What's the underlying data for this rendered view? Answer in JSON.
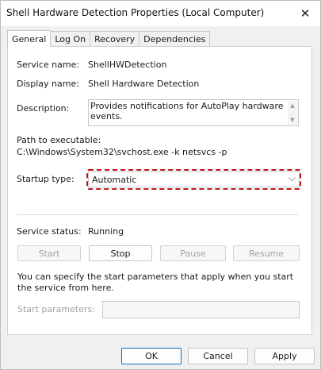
{
  "window": {
    "title": "Shell Hardware Detection Properties (Local Computer)"
  },
  "tabs": [
    {
      "label": "General",
      "active": true
    },
    {
      "label": "Log On",
      "active": false
    },
    {
      "label": "Recovery",
      "active": false
    },
    {
      "label": "Dependencies",
      "active": false
    }
  ],
  "general": {
    "service_name_label": "Service name:",
    "service_name": "ShellHWDetection",
    "display_name_label": "Display name:",
    "display_name": "Shell Hardware Detection",
    "description_label": "Description:",
    "description": "Provides notifications for AutoPlay hardware events.",
    "path_label": "Path to executable:",
    "path": "C:\\Windows\\System32\\svchost.exe -k netsvcs -p",
    "startup_type_label": "Startup type:",
    "startup_type": "Automatic",
    "status_label": "Service status:",
    "status": "Running",
    "buttons": {
      "start": "Start",
      "stop": "Stop",
      "pause": "Pause",
      "resume": "Resume"
    },
    "params_note": "You can specify the start parameters that apply when you start the service from here.",
    "params_label": "Start parameters:",
    "params_value": ""
  },
  "footer": {
    "ok": "OK",
    "cancel": "Cancel",
    "apply": "Apply"
  },
  "colors": {
    "accent": "#0f6cbd",
    "highlight": "#c0131b"
  }
}
